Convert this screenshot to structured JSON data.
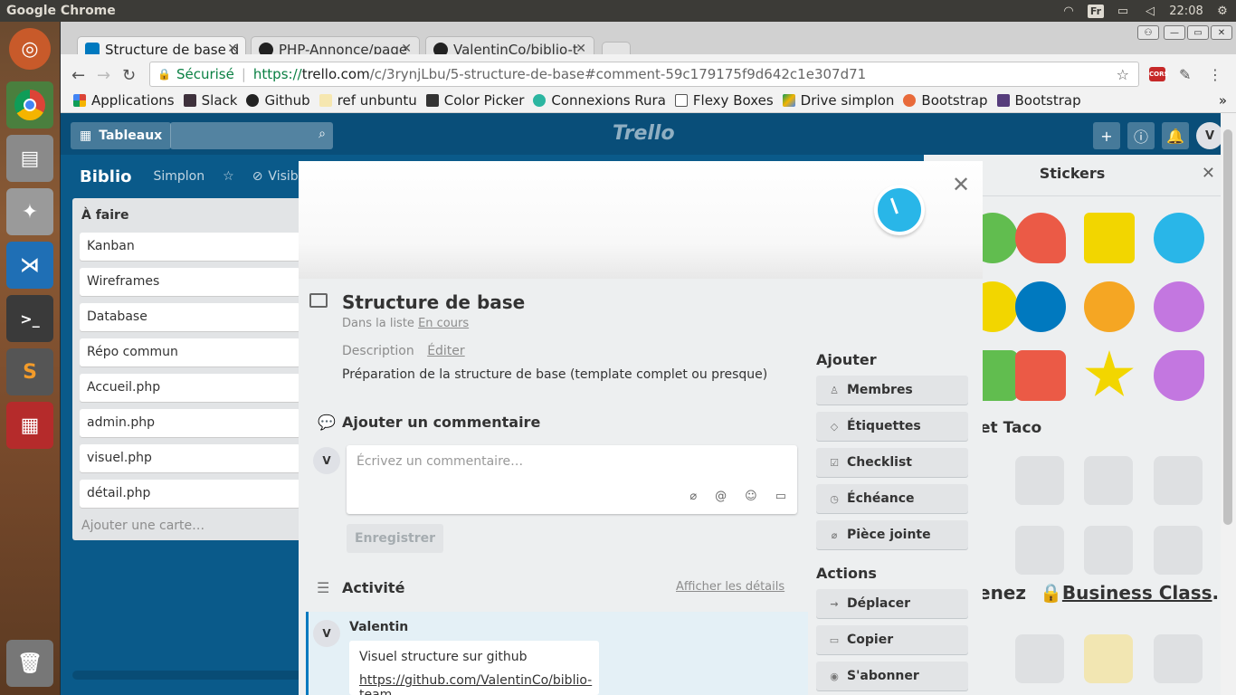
{
  "topbar": {
    "app_title": "Google Chrome",
    "keyboard": "Fr",
    "time": "22:08"
  },
  "tabs": [
    {
      "label": "Structure de base d",
      "active": true
    },
    {
      "label": "PHP-Annonce/page",
      "active": false
    },
    {
      "label": "ValentinCo/biblio-t",
      "active": false
    }
  ],
  "omnibox": {
    "secure_label": "Sécurisé",
    "url_scheme": "https://",
    "url_domain": "trello.com",
    "url_path": "/c/3rynjLbu/5-structure-de-base#comment-59c179175f9d642c1e307d71"
  },
  "bookmarks": [
    "Applications",
    "Slack",
    "Github",
    "ref unbuntu",
    "Color Picker",
    "Connexions Rura",
    "Flexy Boxes",
    "Drive simplon",
    "Bootstrap",
    "Bootstrap"
  ],
  "trello": {
    "boards_button": "Tableaux",
    "logo": "Trello",
    "avatar": "V",
    "board_title": "Biblio",
    "board_team": "Simplon",
    "board_visibility": "Visible",
    "list": {
      "title": "À faire",
      "cards": [
        "Kanban",
        "Wireframes",
        "Database",
        "Répo commun",
        "Accueil.php",
        "admin.php",
        "visuel.php",
        "détail.php"
      ],
      "add_card": "Ajouter une carte…"
    },
    "stickers": {
      "title": "Stickers",
      "section2_partial": "et Taco",
      "upsell_prefix": "enez",
      "upsell_link": "Business Class",
      "upsell_suffix": "."
    }
  },
  "card": {
    "title": "Structure de base",
    "in_list_prefix": "Dans la liste",
    "in_list_name": "En cours",
    "description_label": "Description",
    "description_edit": "Éditer",
    "description_text": "Préparation de la structure de base (template complet ou presque)",
    "add_comment_title": "Ajouter un commentaire",
    "comment_avatar": "V",
    "comment_placeholder": "Écrivez un commentaire…",
    "save_button": "Enregistrer",
    "activity_title": "Activité",
    "show_details": "Afficher les détails",
    "activity": {
      "author": "Valentin",
      "avatar": "V",
      "line1": "Visuel structure sur github",
      "link": "https://github.com/ValentinCo/biblio-team"
    }
  },
  "sidebar": {
    "add_title": "Ajouter",
    "add_buttons": [
      {
        "label": "Membres",
        "icon": "person-icon"
      },
      {
        "label": "Étiquettes",
        "icon": "tag-icon"
      },
      {
        "label": "Checklist",
        "icon": "checkbox-icon"
      },
      {
        "label": "Échéance",
        "icon": "clock-icon"
      },
      {
        "label": "Pièce jointe",
        "icon": "paperclip-icon"
      }
    ],
    "actions_title": "Actions",
    "action_buttons": [
      {
        "label": "Déplacer",
        "icon": "arrow-right-icon"
      },
      {
        "label": "Copier",
        "icon": "card-icon"
      },
      {
        "label": "S'abonner",
        "icon": "eye-icon"
      }
    ]
  },
  "colors": {
    "trello_blue": "#0a5a8a",
    "header_blue": "#094e79",
    "clock_sticker": "#29b6e8",
    "secure_green": "#0a8043"
  }
}
